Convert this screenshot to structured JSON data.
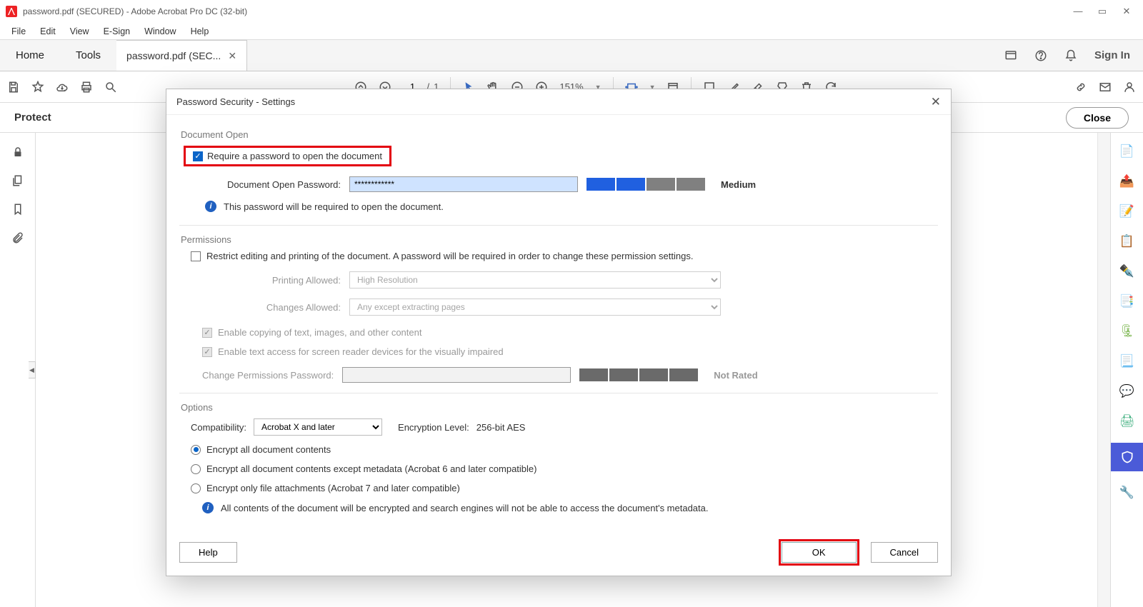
{
  "titlebar": {
    "title": "password.pdf (SECURED) - Adobe Acrobat Pro DC (32-bit)"
  },
  "menu": [
    "File",
    "Edit",
    "View",
    "E-Sign",
    "Window",
    "Help"
  ],
  "tabs": {
    "home": "Home",
    "tools": "Tools",
    "doc": "password.pdf (SEC...",
    "signin": "Sign In"
  },
  "toolbar": {
    "page_current": "1",
    "page_sep": "/",
    "page_total": "1",
    "zoom": "151%"
  },
  "secbar": {
    "label": "Protect",
    "close": "Close"
  },
  "dialog": {
    "title": "Password Security - Settings",
    "sections": {
      "open_head": "Document Open",
      "open_check": "Require a password to open the document",
      "open_pw_label": "Document Open Password:",
      "open_pw_value": "************",
      "open_strength": "Medium",
      "open_info": "This password will be required to open the document.",
      "perm_head": "Permissions",
      "perm_check": "Restrict editing and printing of the document. A password will be required in order to change these permission settings.",
      "perm_print_label": "Printing Allowed:",
      "perm_print_value": "High Resolution",
      "perm_changes_label": "Changes Allowed:",
      "perm_changes_value": "Any except extracting pages",
      "perm_copy": "Enable copying of text, images, and other content",
      "perm_screen": "Enable text access for screen reader devices for the visually impaired",
      "perm_pw_label": "Change Permissions Password:",
      "perm_strength": "Not Rated",
      "opt_head": "Options",
      "compat_label": "Compatibility:",
      "compat_value": "Acrobat X and later",
      "enc_level_label": "Encryption  Level:",
      "enc_level_value": "256-bit AES",
      "enc_all": "Encrypt all document contents",
      "enc_meta": "Encrypt all document contents except metadata (Acrobat 6 and later compatible)",
      "enc_att": "Encrypt only file attachments (Acrobat 7 and later compatible)",
      "enc_info": "All contents of the document will be encrypted and search engines will not be able to access the document's metadata."
    },
    "buttons": {
      "help": "Help",
      "ok": "OK",
      "cancel": "Cancel"
    }
  }
}
